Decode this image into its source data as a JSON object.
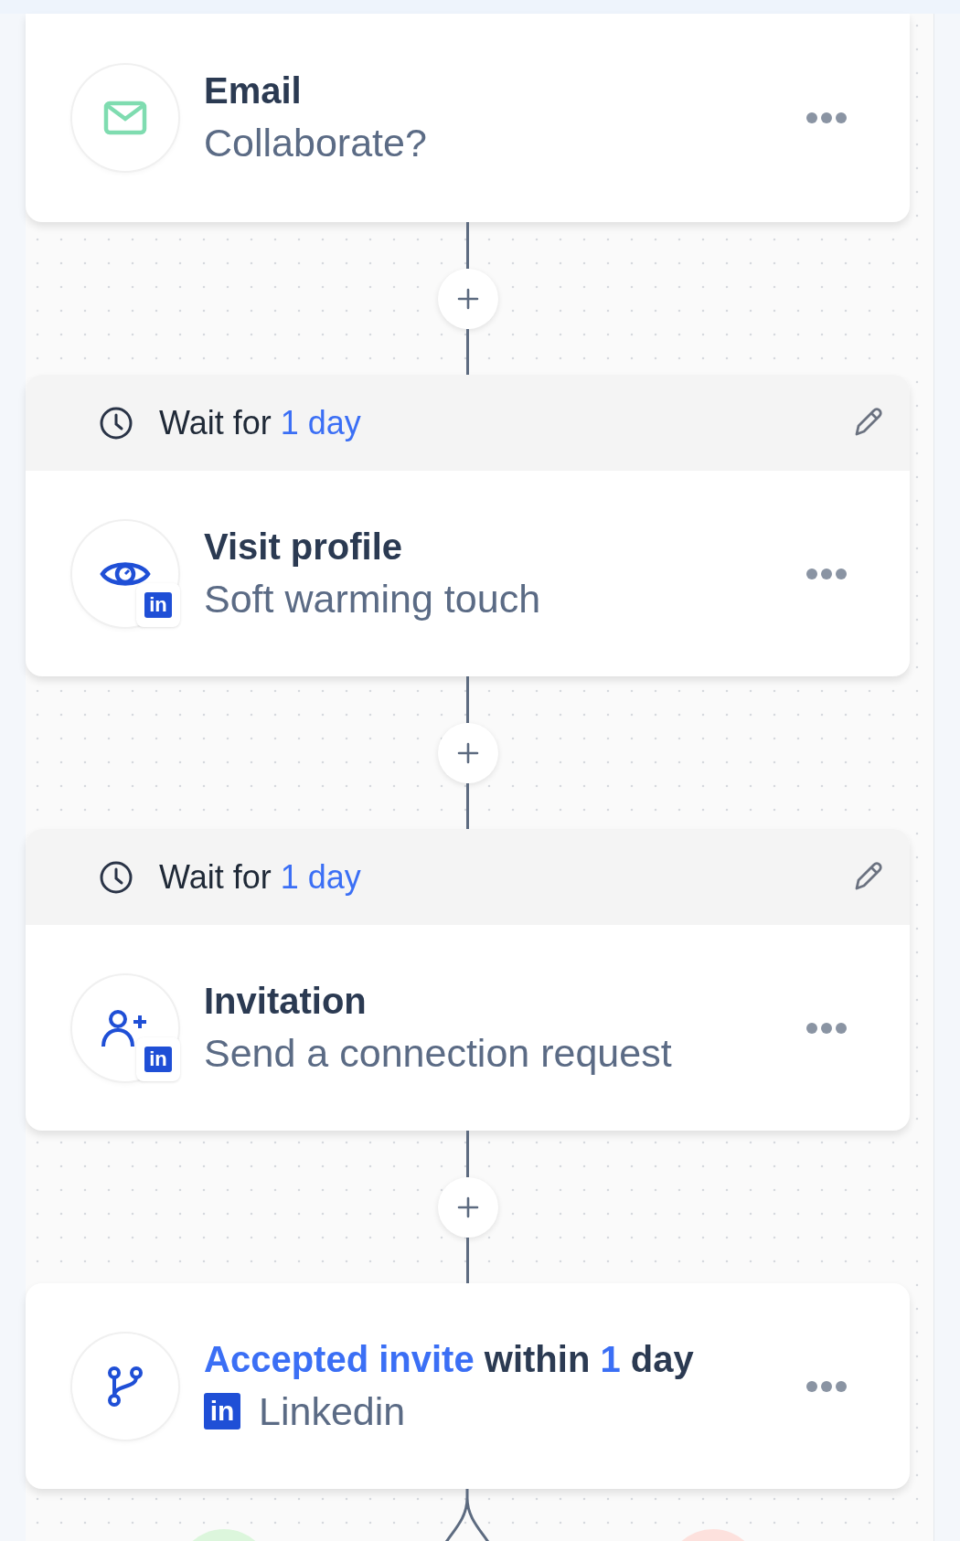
{
  "nodes": [
    {
      "kind": "email",
      "title": "Email",
      "subtitle": "Collaborate?"
    },
    {
      "kind": "visit",
      "wait": [
        {
          "text": "Wait for",
          "highlight": false
        },
        {
          "text": "1 day",
          "highlight": true
        }
      ],
      "title": "Visit profile",
      "subtitle": "Soft warming touch",
      "badge": "in"
    },
    {
      "kind": "invite",
      "wait": [
        {
          "text": "Wait for",
          "highlight": false
        },
        {
          "text": "1 day",
          "highlight": true
        }
      ],
      "title": "Invitation",
      "subtitle": "Send a connection request",
      "badge": "in"
    },
    {
      "kind": "condition",
      "title_parts": [
        {
          "text": "Accepted invite",
          "highlight": true
        },
        {
          "text": "within",
          "highlight": false
        },
        {
          "text": "1",
          "highlight": true
        },
        {
          "text": "day",
          "highlight": false
        }
      ],
      "subtitle": "Linkedin",
      "badge": "in"
    }
  ],
  "branches": [
    {
      "color": "#dcf6dc"
    },
    {
      "color": "#fde1dd"
    }
  ]
}
